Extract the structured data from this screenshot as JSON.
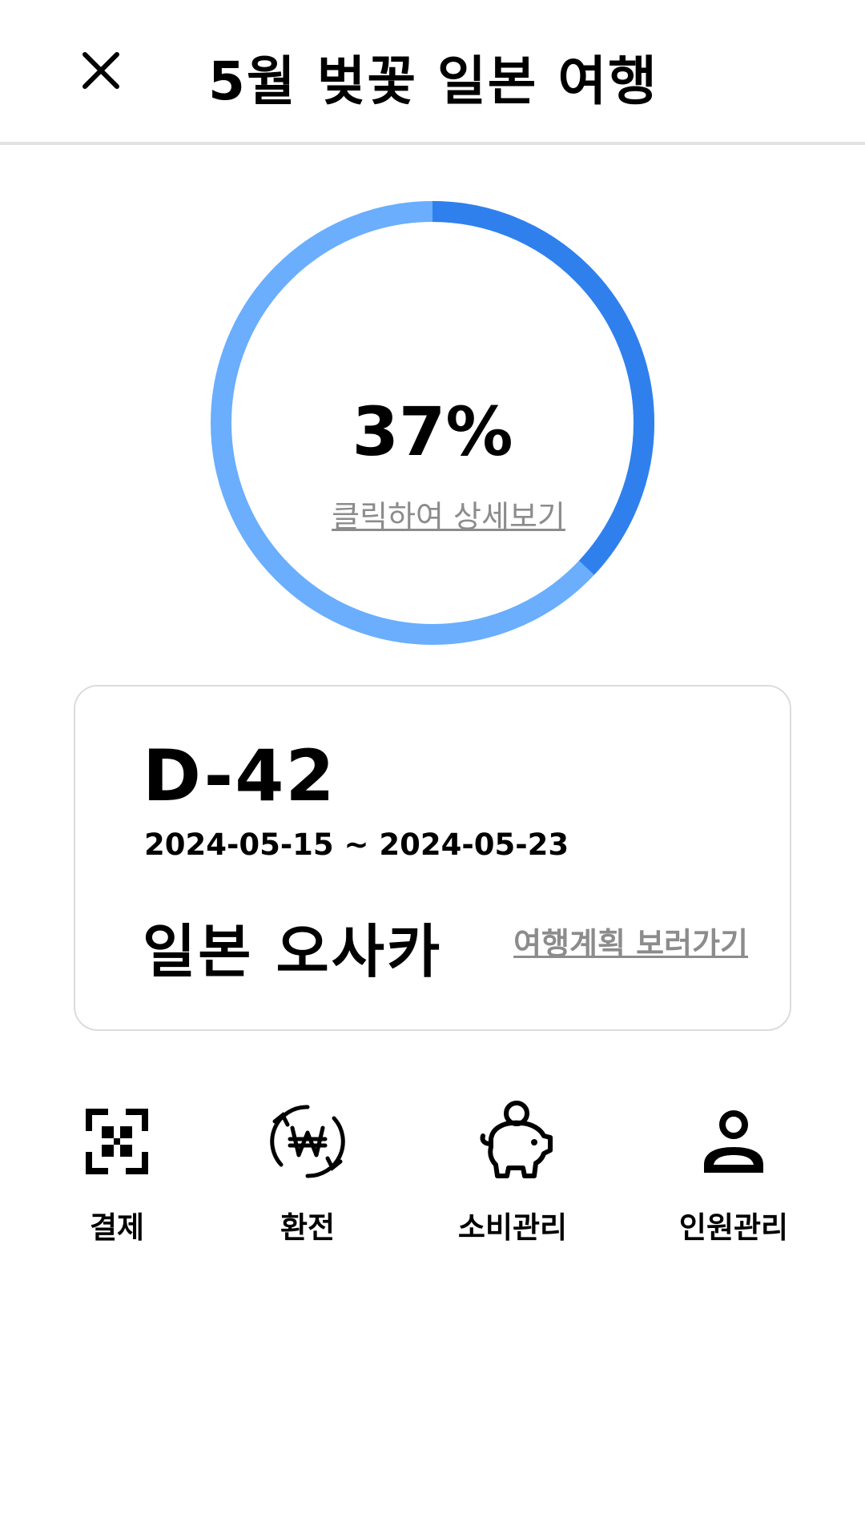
{
  "header": {
    "title": "5월 벚꽃 일본 여행",
    "close_icon": "close-icon"
  },
  "progress": {
    "value_percent": 37,
    "label": "37%",
    "detail_link": "클릭하여 상세보기",
    "colors": {
      "filled": "#2f80ed",
      "track": "#6aaefd"
    }
  },
  "trip": {
    "dday": "D-42",
    "date_range": "2024-05-15 ~ 2024-05-23",
    "destination": "일본 오사카",
    "plan_link": "여행계획 보러가기"
  },
  "menu": {
    "items": [
      {
        "label": "결제",
        "icon": "qr-scan-icon"
      },
      {
        "label": "환전",
        "icon": "won-exchange-icon"
      },
      {
        "label": "소비관리",
        "icon": "piggy-bank-icon"
      },
      {
        "label": "인원관리",
        "icon": "person-icon"
      }
    ]
  }
}
